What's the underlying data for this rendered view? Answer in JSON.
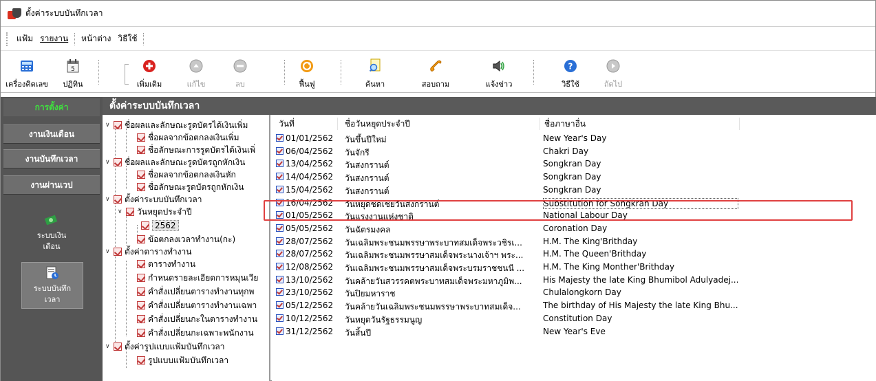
{
  "window": {
    "title": "ตั้งค่าระบบบันทึกเวลา"
  },
  "menu": {
    "items": [
      "แฟ้ม",
      "รายงาน",
      "หน้าต่าง",
      "วิธีใช้"
    ]
  },
  "toolbar": {
    "calculator": "เครื่องคิดเลข",
    "calendar": "ปฏิทิน",
    "add": "เพิ่มเติม",
    "edit": "แก้ไข",
    "delete": "ลบ",
    "restore": "ฟื้นฟู",
    "search": "ค้นหา",
    "inquire": "สอบถาม",
    "notify": "แจ้งข่าว",
    "help": "วิธีใช้",
    "next": "ถัดไป"
  },
  "nav": {
    "header": "การตั้งค่า",
    "buttons": [
      "งานเงินเดือน",
      "งานบันทึกเวลา",
      "งานผ่านเวป"
    ],
    "tiles": [
      "ระบบเงินเดือน",
      "ระบบบันทึกเวลา"
    ],
    "tile_lines": [
      [
        "ระบบเงิน",
        "เดือน"
      ],
      [
        "ระบบบันทึก",
        "เวลา"
      ]
    ]
  },
  "content": {
    "header": "ตั้งค่าระบบบันทึกเวลา"
  },
  "tree": {
    "nodes": [
      "ชื่อผลและลักษณะรูดบัตรได้เงินเพิ่ม",
      "ชื่อผลจากข้อตกลงเงินเพิ่ม",
      "ชื่อลักษณะการรูดบัตรได้เงินเพิ่",
      "ชื่อผลและลักษณะรูดบัตรถูกหักเงิน",
      "ชื่อผลจากข้อตกลงเงินหัก",
      "ชื่อลักษณะรูดบัตรถูกหักเงิน",
      "ตั้งค่าระบบบันทึกเวลา",
      "วันหยุดประจำปี",
      "2562",
      "ข้อตกลงเวลาทำงาน(กะ)",
      "ตั้งค่าตารางทำงาน",
      "ตารางทำงาน",
      "กำหนดรายละเอียดการหมุนเวีย",
      "คำสั่งเปลี่ยนตารางทำงานทุกพ",
      "คำสั่งเปลี่ยนตารางทำงานเฉพา",
      "คำสั่งเปลี่ยนกะในตารางทำงาน",
      "คำสั่งเปลี่ยนกะเฉพาะพนักงาน",
      "ตั้งค่ารูปแบบแฟ้มบันทึกเวลา",
      "รูปแบบแฟ้มบันทึกเวลา"
    ]
  },
  "grid": {
    "columns": [
      "วันที่",
      "ชื่อวันหยุดประจำปี",
      "ชื่อภาษาอื่น"
    ],
    "rows": [
      [
        "01/01/2562",
        "วันขึ้นปีใหม่",
        "New Year's Day"
      ],
      [
        "06/04/2562",
        "วันจักรี",
        "Chakri Day"
      ],
      [
        "13/04/2562",
        "วันสงกรานต์",
        "Songkran Day"
      ],
      [
        "14/04/2562",
        "วันสงกรานต์",
        "Songkran Day"
      ],
      [
        "15/04/2562",
        "วันสงกรานต์",
        "Songkran Day"
      ],
      [
        "16/04/2562",
        "วันหยุดชดเชยวันสงกรานต์",
        "Substitution for Songkran Day"
      ],
      [
        "01/05/2562",
        "วันแรงงานแห่งชาติ",
        "National Labour Day"
      ],
      [
        "05/05/2562",
        "วันฉัตรมงคล",
        "Coronation Day"
      ],
      [
        "28/07/2562",
        "วันเฉลิมพระชนมพรรษาพระบาทสมเด็จพระวชิรเ...",
        "H.M. The King'Brithday"
      ],
      [
        "28/07/2562",
        "วันเฉลิมพระชนมพรรษาสมเด็จพระนางเจ้าฯ พระ...",
        "H.M. The Queen'Brithday"
      ],
      [
        "12/08/2562",
        "วันเฉลิมพระชนมพรรษาสมเด็จพระบรมราชชนนี ...",
        "H.M. The King Monther'Brithday"
      ],
      [
        "13/10/2562",
        "วันคล้ายวันสวรรคตพระบาทสมเด็จพระมหาภูมิพ...",
        "His Majesty the late King Bhumibol Adulyadej..."
      ],
      [
        "23/10/2562",
        "วันปิยมหาราช",
        "Chulalongkorn Day"
      ],
      [
        "05/12/2562",
        "วันคล้ายวันเฉลิมพระชนมพรรษาพระบาทสมเด็จ...",
        "The birthday of His Majesty the late King Bhu..."
      ],
      [
        "10/12/2562",
        "วันหยุดวันรัฐธรรมนูญ",
        "Constitution Day"
      ],
      [
        "31/12/2562",
        "วันสิ้นปี",
        "New Year's Eve"
      ]
    ],
    "selected_row": 5
  },
  "colors": {
    "nav_bg": "#555555",
    "nav_active": "#3fe03f",
    "highlight": "#e04040"
  }
}
